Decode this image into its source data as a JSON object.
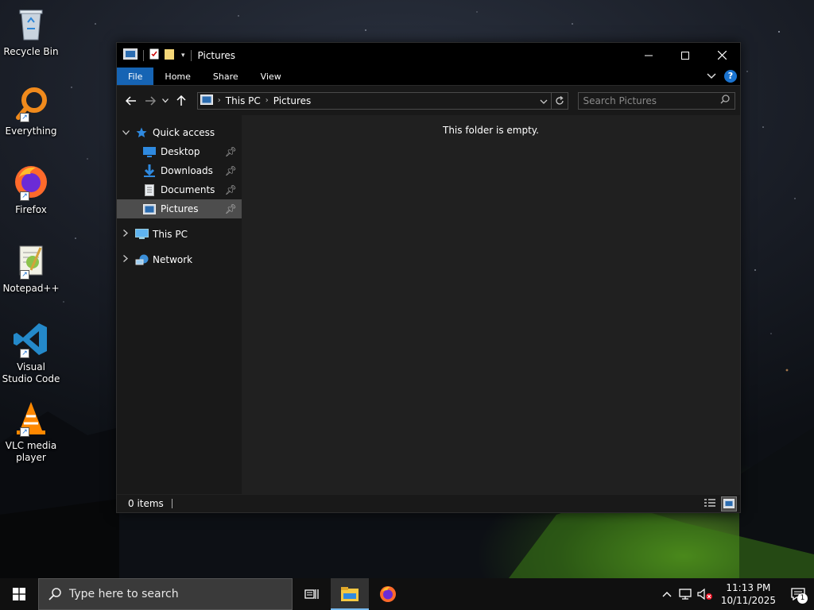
{
  "desktop": {
    "icons": [
      {
        "label": "Recycle Bin",
        "icon": "recycle-bin-icon"
      },
      {
        "label": "Everything",
        "icon": "everything-search-icon"
      },
      {
        "label": "Firefox",
        "icon": "firefox-icon"
      },
      {
        "label": "Notepad++",
        "icon": "notepad-plus-plus-icon"
      },
      {
        "label": "Visual Studio Code",
        "icon": "vscode-icon"
      },
      {
        "label": "VLC media player",
        "icon": "vlc-icon"
      }
    ]
  },
  "window": {
    "title": "Pictures",
    "ribbon_tabs": [
      "File",
      "Home",
      "Share",
      "View"
    ],
    "help": "?",
    "address": {
      "crumbs": [
        "This PC",
        "Pictures"
      ]
    },
    "search": {
      "placeholder": "Search Pictures"
    },
    "nav": {
      "quick_access": "Quick access",
      "items": [
        {
          "label": "Desktop",
          "icon": "desktop-folder-icon"
        },
        {
          "label": "Downloads",
          "icon": "downloads-folder-icon"
        },
        {
          "label": "Documents",
          "icon": "documents-folder-icon"
        },
        {
          "label": "Pictures",
          "icon": "pictures-folder-icon"
        }
      ],
      "this_pc": "This PC",
      "network": "Network"
    },
    "empty_message": "This folder is empty.",
    "status": {
      "items": "0 items"
    }
  },
  "taskbar": {
    "search_placeholder": "Type here to search",
    "time": "11:13 PM",
    "date": "10/11/2025",
    "notification_count": "1"
  },
  "colors": {
    "accent": "#1664b4",
    "window_bg": "#191919",
    "content_bg": "#202020",
    "selected": "#4d4d4d"
  }
}
